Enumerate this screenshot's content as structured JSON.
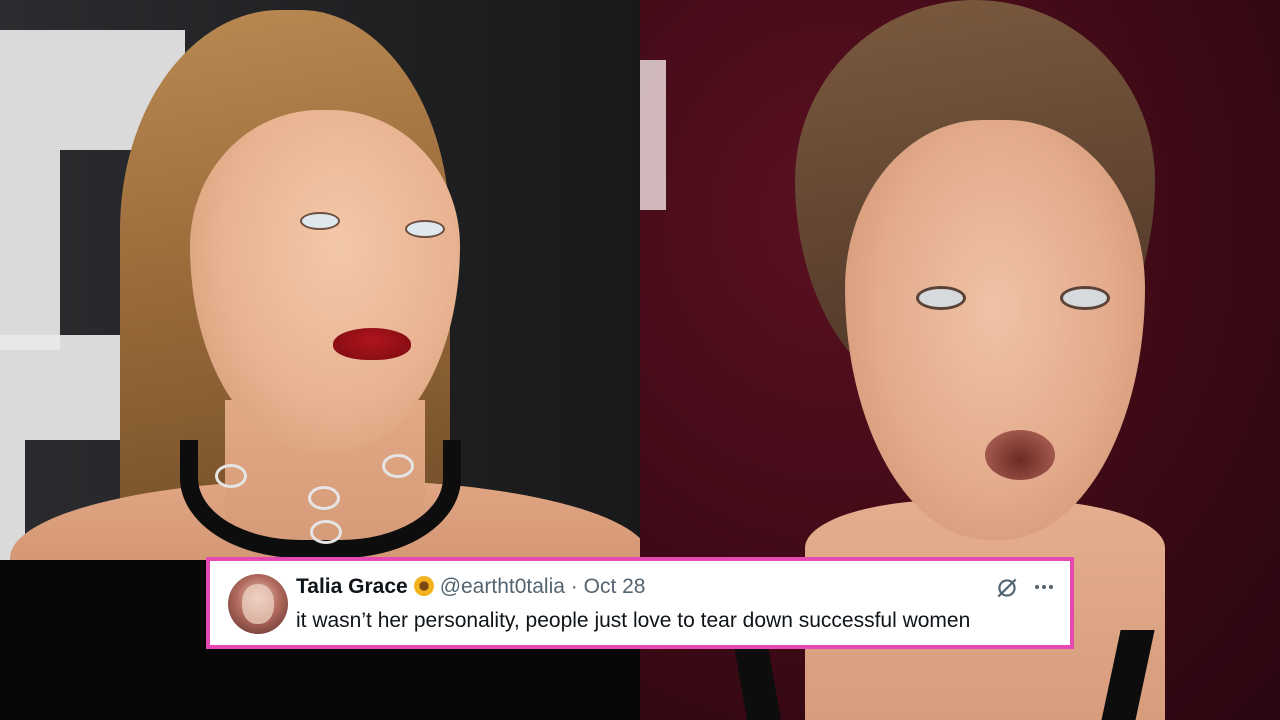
{
  "tweet": {
    "display_name": "Talia Grace",
    "handle": "@eartht0talia",
    "separator": "·",
    "date": "Oct 28",
    "text": "it wasn’t her personality, people just love to tear down successful women",
    "badge_icon": "sunflower-emoji",
    "action_icons": [
      "grok-icon",
      "more-icon"
    ]
  },
  "colors": {
    "tweet_border": "#e64ab2",
    "tweet_background": "#ffffff",
    "name_color": "#0f1419",
    "meta_color": "#536471"
  }
}
